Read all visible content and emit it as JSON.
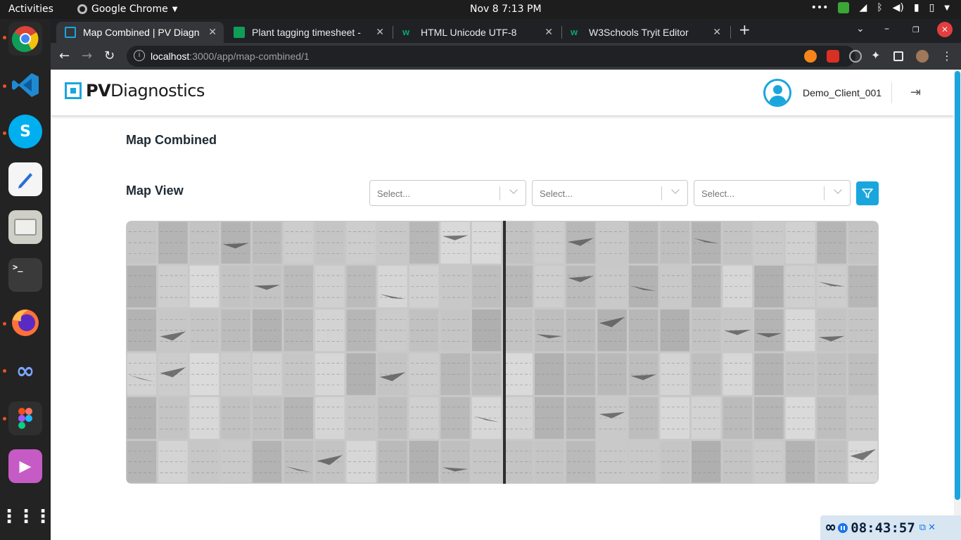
{
  "os": {
    "activities": "Activities",
    "app_menu": "Google Chrome",
    "clock": "Nov 8   7:13 PM"
  },
  "browser": {
    "tabs": [
      {
        "title": "Map Combined | PV Diagn",
        "active": true
      },
      {
        "title": "Plant tagging timesheet -",
        "active": false
      },
      {
        "title": "HTML Unicode UTF-8",
        "active": false
      },
      {
        "title": "W3Schools Tryit Editor",
        "active": false
      }
    ],
    "url_host": "localhost",
    "url_path": ":3000/app/map-combined/1"
  },
  "app": {
    "brand_bold": "PV",
    "brand_rest": "Diagnostics",
    "username": "Demo_Client_001",
    "page_title": "Map Combined",
    "section_title": "Map View",
    "filters": [
      {
        "placeholder": "Select..."
      },
      {
        "placeholder": "Select..."
      },
      {
        "placeholder": "Select..."
      }
    ]
  },
  "timer": {
    "value": "08:43:57"
  },
  "colors": {
    "accent": "#1aa6dd",
    "title_text": "#1f2a33"
  }
}
